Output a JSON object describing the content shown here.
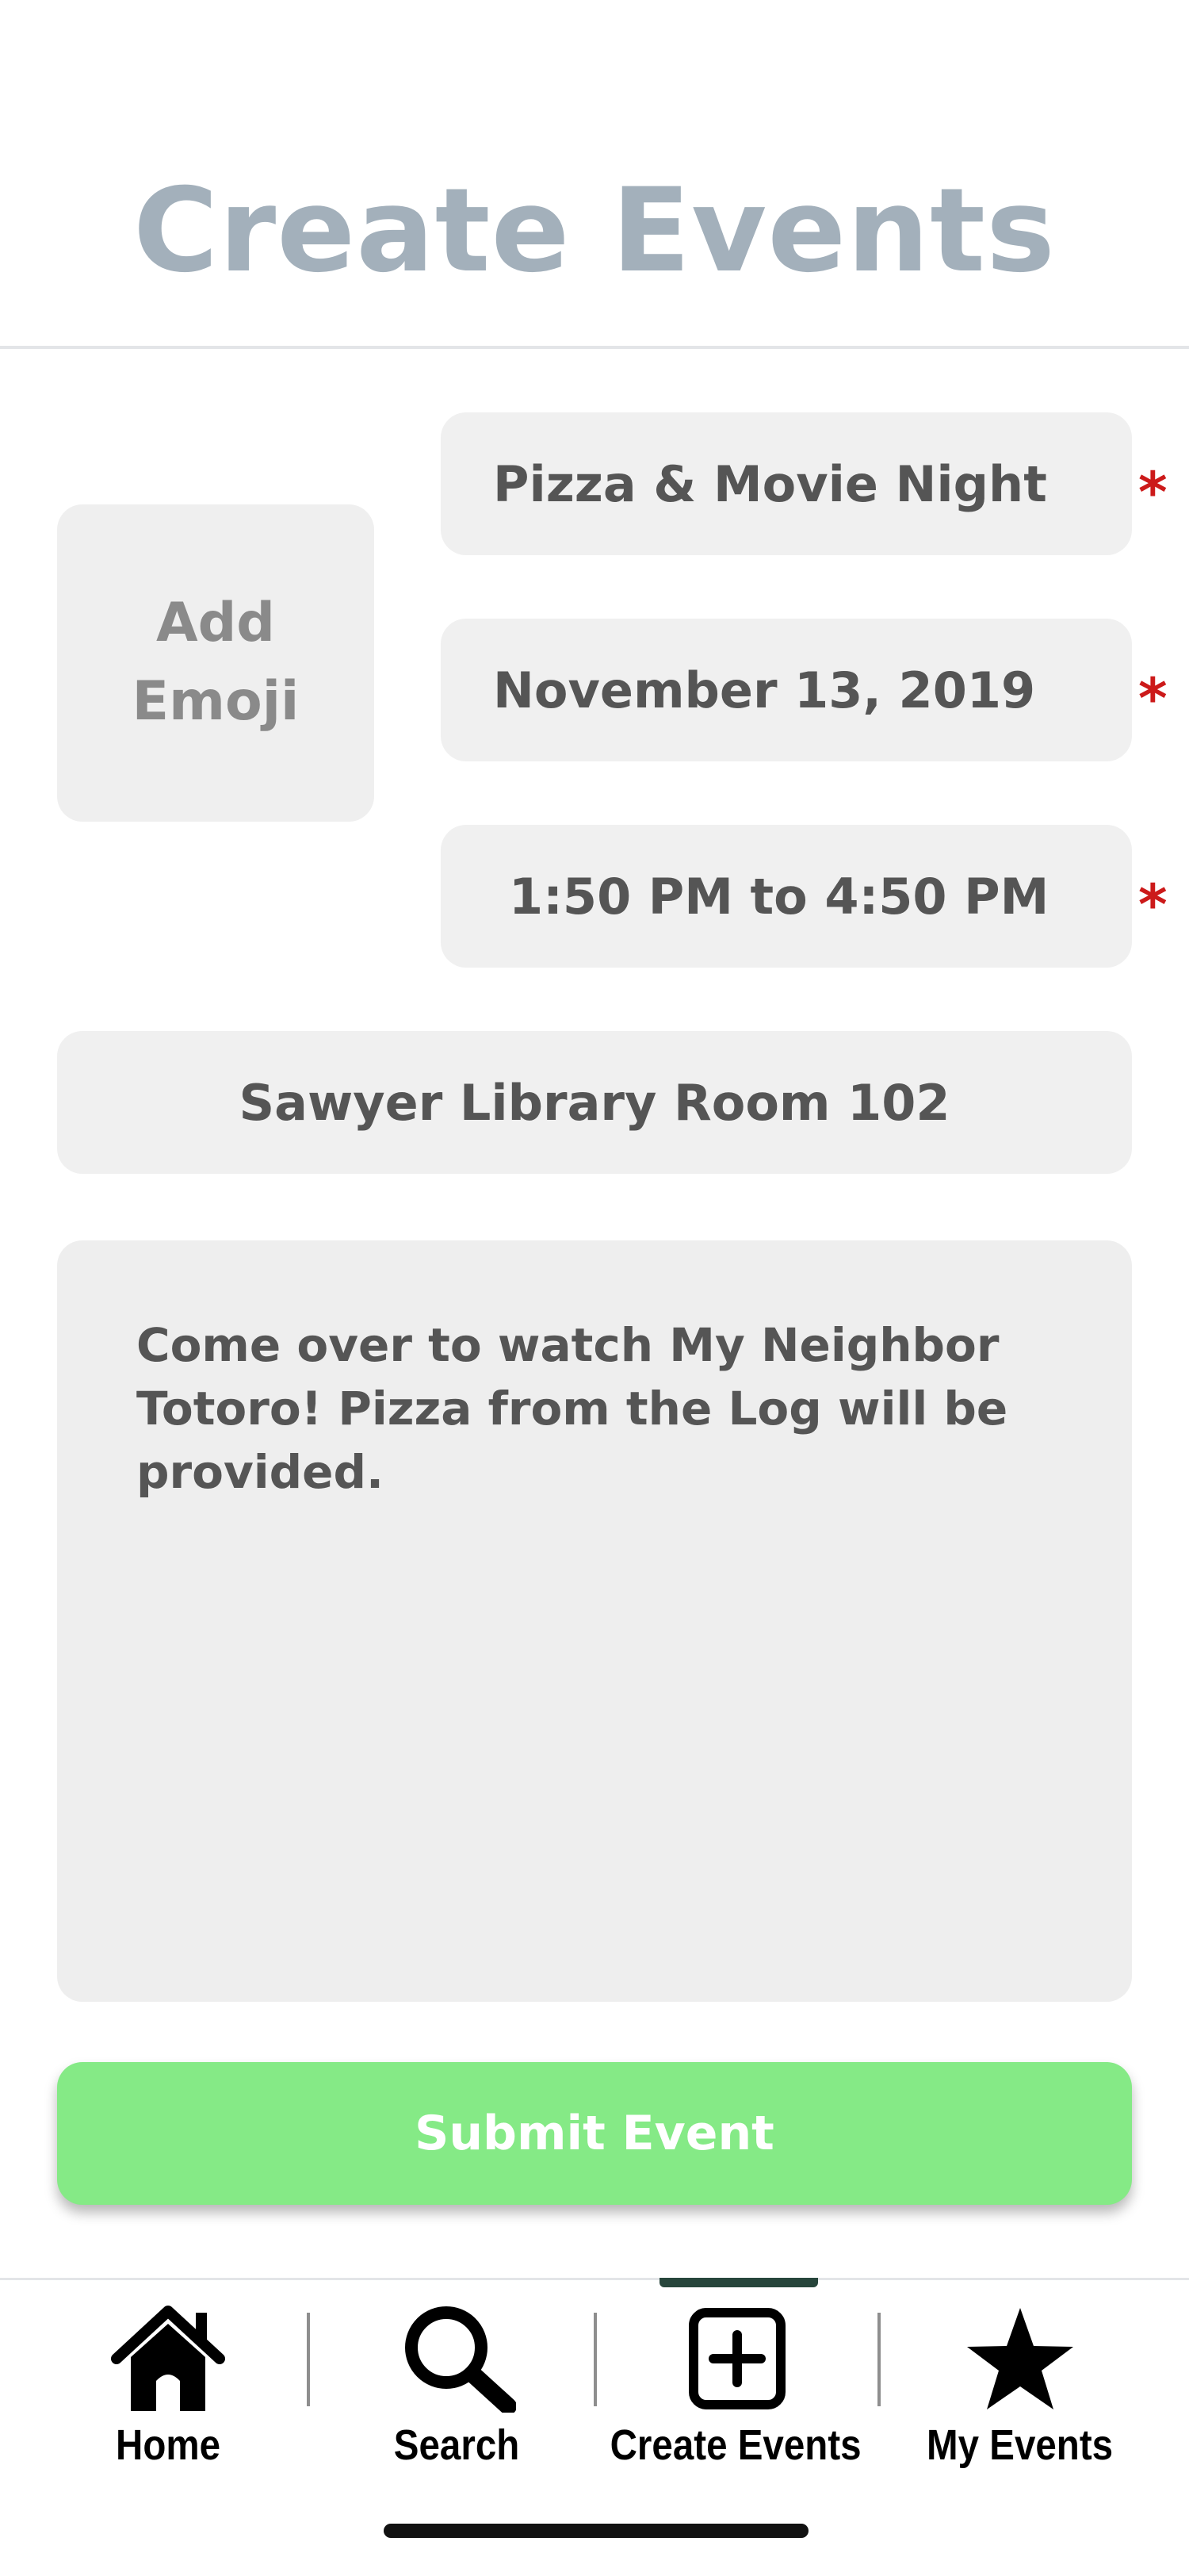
{
  "header": {
    "title": "Create Events"
  },
  "form": {
    "emoji_label_line1": "Add",
    "emoji_label_line2": "Emoji",
    "name_value": "Pizza & Movie Night",
    "date_value": "November 13, 2019",
    "time_value": "1:50 PM to 4:50 PM",
    "location_value": "Sawyer Library Room 102",
    "description_value": "Come over to watch My Neighbor Totoro! Pizza from the Log will be provided.",
    "required_marker": "*",
    "submit_label": "Submit Event"
  },
  "nav": {
    "items": [
      {
        "label": "Home",
        "icon": "home-icon"
      },
      {
        "label": "Search",
        "icon": "search-icon"
      },
      {
        "label": "Create Events",
        "icon": "plus-square-icon"
      },
      {
        "label": "My Events",
        "icon": "star-icon"
      }
    ],
    "active": "Create Events"
  },
  "colors": {
    "title": "#a3b0bb",
    "required": "#cc1a1a",
    "submit_bg": "#85ea86",
    "field_bg": "#f0f0f0",
    "active_indicator": "#27453b"
  }
}
